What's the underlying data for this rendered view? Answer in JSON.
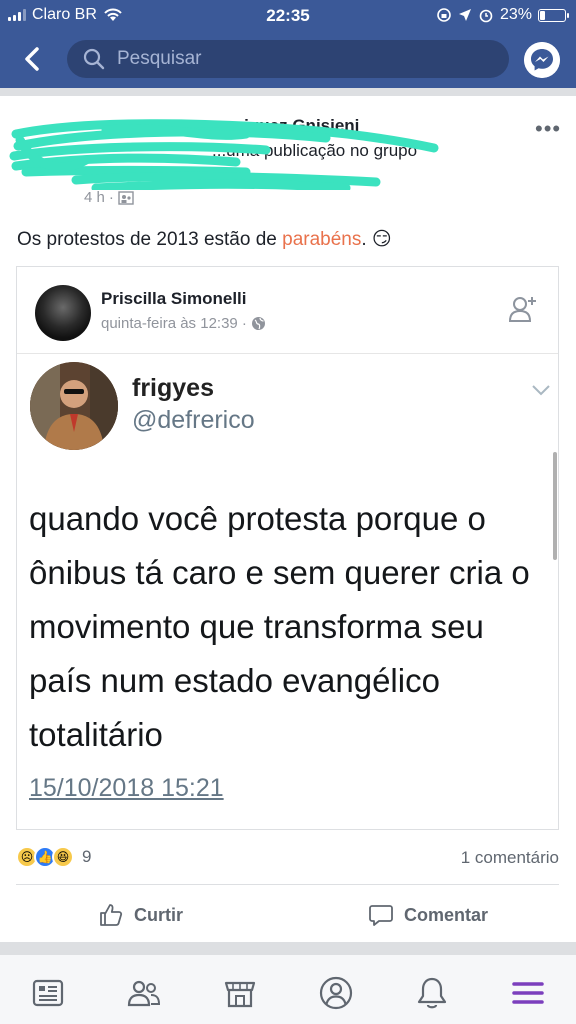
{
  "status_bar": {
    "carrier": "Claro BR",
    "time": "22:35",
    "battery": "23%"
  },
  "nav": {
    "search_placeholder": "Pesquisar",
    "back_icon": "chevron-left-icon",
    "messenger_icon": "messenger-icon"
  },
  "post": {
    "author_partial": "...iquez Gnisieni",
    "action_partial": "...uma publicação no grupo",
    "time": "4 h",
    "audience_icon": "group-icon",
    "text_before": "Os protestos de 2013 estão de ",
    "text_highlight": "parabéns",
    "text_after": ". 😏",
    "shared": {
      "name": "Priscilla Simonelli",
      "meta": "quinta-feira às 12:39 ·",
      "tweet": {
        "name": "frigyes",
        "handle": "@defrerico",
        "body": "quando você protesta porque o ônibus tá caro e sem querer cria o movimento que transforma seu país num estado evangélico totalitário",
        "date": "15/10/2018 15:21"
      }
    },
    "reaction_count": "9",
    "comments": "1 comentário",
    "like_label": "Curtir",
    "comment_label": "Comentar"
  },
  "colors": {
    "brand": "#3b5998",
    "highlight": "#e9724c",
    "tab_active": "#7b3fbd"
  },
  "tabbar": [
    "news-feed-icon",
    "friends-icon",
    "marketplace-icon",
    "profile-icon",
    "notifications-icon",
    "menu-icon"
  ]
}
